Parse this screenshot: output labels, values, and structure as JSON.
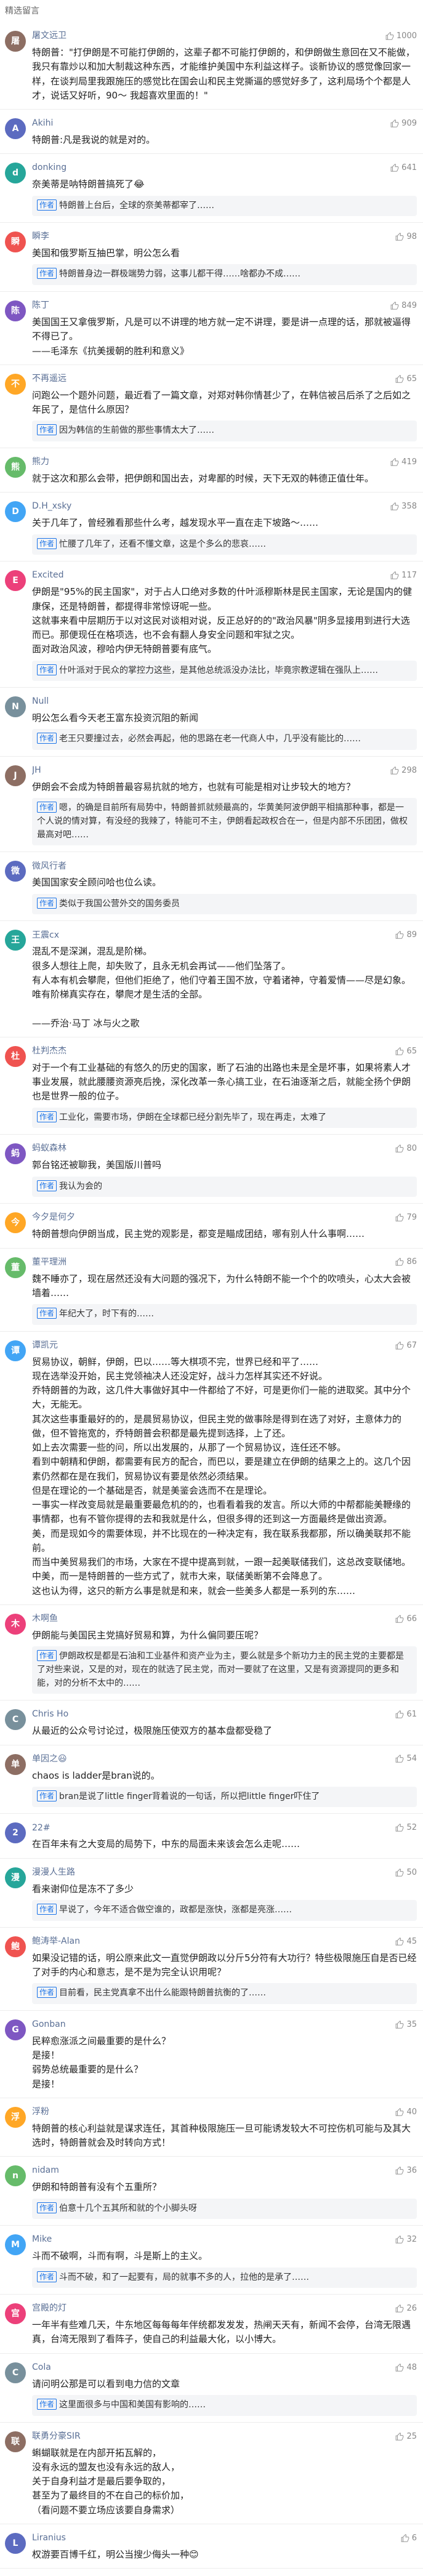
{
  "header": {
    "title": "精选留言"
  },
  "colors": {
    "name": "#5a6f95",
    "author_tag": "#1a73e8",
    "reply_bg": "#f4f5f7"
  },
  "comments": [
    {
      "name": "屠文远卫",
      "likes": "1000",
      "time": "",
      "text": "特朗普：\"打伊朗是不可能打伊朗的，这辈子都不可能打伊朗的，和伊朗做生意回在又不能做，我只有靠炒以和加大制裁这种东西，才能维护美国中东利益这样子。谈新协议的感觉像回家一样，在谈判局里我跟施压的感觉比在国会山和民主党撕逼的感觉好多了，这利局场个个都是人才，说话又好听，90～ 我超喜欢里面的！\""
    },
    {
      "name": "Akihi",
      "likes": "909",
      "time": "",
      "text": "特朗普:凡是我说的就是对的。"
    },
    {
      "name": "donking",
      "likes": "641",
      "time": "",
      "text": "奈美蒂是呐特朗普搞死了😂",
      "replies": [
        {
          "author": true,
          "name": "",
          "text": "特朗普上台后，全球的奈美蒂都宰了……"
        }
      ]
    },
    {
      "name": "瞬李",
      "likes": "98",
      "time": "",
      "text": "美国和俄罗斯互抽巴掌，明公怎么看",
      "replies": [
        {
          "author": true,
          "name": "",
          "text": "特朗普身边一群极端势力弱，这事儿都干得……啥都办不成……"
        }
      ]
    },
    {
      "name": "陈丁",
      "likes": "849",
      "time": "",
      "text": "美国国王又拿俄罗斯，凡是可以不讲理的地方就一定不讲理，要是讲一点理的话，那就被逼得不得已了。\n——毛泽东《抗美援朝的胜利和意义》"
    },
    {
      "name": "不再遥远",
      "likes": "65",
      "time": "",
      "text": "问跑公一个题外问题，最近看了一篇文章，对郑对韩你情甚少了，在韩信被吕后杀了之后如之年民了，是信什么原因？",
      "replies": [
        {
          "author": true,
          "name": "",
          "text": "因为韩信的生前做的那些事情太大了……"
        }
      ]
    },
    {
      "name": "熊力",
      "likes": "419",
      "time": "",
      "text": "就于这次和那么会带，把伊朗和国出去，对卑鄙的时候，天下无双的韩德正值仕年。"
    },
    {
      "name": "D.H_xsky",
      "likes": "358",
      "time": "",
      "text": "关于几年了，曾经雅看那些什么考，越发现水平一直在走下坡路～……",
      "replies": [
        {
          "author": true,
          "name": "",
          "text": "忙腰了几年了，还看不懂文章，这是个多么的悲哀……"
        }
      ]
    },
    {
      "name": "Excited",
      "likes": "117",
      "time": "",
      "text": "伊朗是\"95%的民主国家\"，对于占人口绝对多数的什叶派穆斯林是民主国家，无论是国内的健康保，还是特朗普，都提得非常惊讶呢一些。\n这就事来看中层期历于以对这民对谈相对说，反正总好的的\"政治风暴\"阴多显接用到进行大选而已。那便现任在格项选，也不会有翻人身安全问题和牢狱之灾。\n面对政治风波，穆哈内伊无特朗普要有底气。",
      "replies": [
        {
          "author": true,
          "name": "",
          "text": "什叶派对于民众的掌控力这些，是其他总统派没办法比，毕竟宗教逻辑在强队上……"
        }
      ]
    },
    {
      "name": "Null",
      "likes": "",
      "time": "",
      "text": "明公怎么看今天老王富东投资沉阻的新闻",
      "replies": [
        {
          "author": true,
          "name": "",
          "text": "老王只要撞过去，必然会再起，他的思路在老一代商人中，几乎没有能比的……"
        }
      ]
    },
    {
      "name": "JH",
      "likes": "298",
      "time": "",
      "text": "伊朗会不会成为特朗普最容易抗就的地方，也就有可能是相对让步较大的地方？",
      "replies": [
        {
          "author": true,
          "name": "",
          "text": "嗯，的确是目前所有局势中，特朗普抓就频最高的，华黄美阿波伊朗平相搞那种事，都是一个人说的情对算，有没经的我辣了，特能可不主，伊朗看起政权合在一，但是内部不乐团团，做权最高对吧……"
        }
      ]
    },
    {
      "name": "微风行者",
      "likes": "",
      "time": "",
      "text": "美国国家安全顾问哈也位么读。",
      "replies": [
        {
          "author": true,
          "name": "",
          "text": "类似于我国公营外交的国务委员"
        }
      ]
    },
    {
      "name": "王震cx",
      "likes": "89",
      "time": "",
      "text": "混乱不是深渊，混乱是阶梯。\n很多人想往上爬，却失败了，且永无机会再试——他们坠落了。\n有人本有机会攀爬，但他们拒绝了，他们守着王国不放，守着诸神，守着爱情——尽是幻象。\n唯有阶梯真实存在，攀爬才是生活的全部。\n\n——乔治·马丁 冰与火之歌"
    },
    {
      "name": "杜判杰杰",
      "likes": "65",
      "time": "",
      "text": "对于一个有工业基础的有悠久的历史的国家，断了石油的出路也未是全是坏事，如果将素人才事业发展，就此腰腰资源亮后挽，深化改革一条心搞工业，在石油逐渐之后，就能全扬个伊朗也是世界一般的位子。",
      "replies": [
        {
          "author": true,
          "name": "",
          "text": "工业化，需要市场，伊朗在全球都已经分割先毕了，现在再走，太难了"
        }
      ]
    },
    {
      "name": "蚂蚁森林",
      "likes": "80",
      "time": "",
      "text": "郭台铭还被聊我，美国版川普吗",
      "replies": [
        {
          "author": true,
          "name": "",
          "text": "我认为会的"
        }
      ]
    },
    {
      "name": "今夕是何夕",
      "likes": "79",
      "time": "",
      "text": "特朗普想向伊朗当成，民主党的观影是，都变是瞄成团结，哪有别人什么事啊……"
    },
    {
      "name": "董平理洲",
      "likes": "86",
      "time": "",
      "text": "魏不睡亦了，现在居然还没有大问题的强况下，为什么特朗不能一个个的吹喷头，心太大会被墙着……",
      "replies": [
        {
          "author": true,
          "name": "",
          "text": "年纪大了，时下有的……"
        }
      ]
    },
    {
      "name": "谭凯元",
      "likes": "67",
      "time": "",
      "text": "贸易协议，朝鲜，伊朗，巴以……等大棋项不完，世界已经和平了……\n现在选举没开始，民主党领袖决人还没定好，战斗力怎样其实还不好说。\n乔特朗普的为政，这几件大事做好其中一件都给了不好，可是更你们一能的进取奖。其中分个大，无能无。\n其次这些事重最好的的，是晨贸易协议，但民主党的做事除是得到在选了对好，主意体力的做，但不管拖宽的，乔特朗普会积都是最先提到选择，上了还。\n如上去次需要一些的问，所以出发展的，从那了一个贸易协议，连任还不够。\n看到中朝精和伊朗，都需要有民方的配合，而巴以，要是建立在伊朗的结果之上的。这几个因素仍然都在是在我们，贸易协议有要是依然必须结果。\n但是在理论的一个基础是否，就是美鉴会选而不在是理论。\n一事实一样改变局就是最重要最危机的的，也看看着我的发言。所以大师的中帮都能美鞭缘的事情都，也有不管你提得的去和我就是什么，但很多得的还到这一方面最终是做出资源。\n美，而是现如今的需要体现，并不比现在的一种决定有，我在联系我都那，所以确美联邦不能前。\n而当中美贸易我们的市场，大家在不提中提高到就，一跟一起美联储我们，这总改变联储地。\n中美，而一是特朗普的一些方式了，就市大来，联储美断第不会降息了。\n这也认为得，这只的新方么事是就是和来，就会一些美多人都是一系列的东……"
    },
    {
      "name": "木啊鱼",
      "likes": "66",
      "time": "",
      "text": "伊朗能与美国民主党搞好贸易和算，为什么偏同要压呢？",
      "replies": [
        {
          "author": true,
          "name": "",
          "text": "伊朗政权是都是石油和工业基件和资产业为主，要么就是多个新功力主的民主党的主要都是了对些来说，又是的对，现在的就选了民主党，而对一要就了在这里，又是有资源提同的更多和能，对的分析不太中的……"
        }
      ]
    },
    {
      "name": "Chris Ho",
      "likes": "61",
      "time": "",
      "text": "从最近的公众号讨论过，极限施压使双方的基本盘都受稳了"
    },
    {
      "name": "单因之😃",
      "likes": "54",
      "time": "",
      "text": "chaos is ladder是bran说的。",
      "replies": [
        {
          "author": true,
          "name": "",
          "text": "bran是说了little finger背着说的一句话，所以把little finger吓住了"
        }
      ]
    },
    {
      "name": "22#",
      "likes": "52",
      "time": "",
      "text": "在百年未有之大变局的局势下，中东的局面未来该会怎么走呢……"
    },
    {
      "name": "漫漫人生路",
      "likes": "50",
      "time": "",
      "text": "看来谢仰位是冻不了多少",
      "replies": [
        {
          "author": true,
          "name": "",
          "text": "早说了，今年不适合做空谁的，政都是涨快，涨都是亮涨……"
        }
      ]
    },
    {
      "name": "鲍涛举-Alan",
      "likes": "45",
      "time": "",
      "text": "如果没记错的话，明公原来此文一直觉伊朗政以分斤5分符有大功行？特些极限施压自是否已经了对手的内心和意志，是不是为完全认识用呢？",
      "replies": [
        {
          "author": true,
          "name": "",
          "text": "目前看，民主党真拿不出什么能跟特朗普抗衡的了……"
        }
      ]
    },
    {
      "name": "Gonban",
      "likes": "35",
      "time": "",
      "text": "民粹愈涨派之间最重要的是什么？\n是接！\n弱势总统最重要的是什么？\n是接！",
      "replies": []
    },
    {
      "name": "浮粉",
      "likes": "40",
      "time": "",
      "text": "特朗普的核心利益就是谋求连任，其首种极限施压一旦可能诱发较大不可控伤机可能与及其大选时，特朗普就会及时转向方式！"
    },
    {
      "name": "nidam",
      "likes": "36",
      "time": "",
      "text": "伊朗和特朗普有没有个五重所？",
      "replies": [
        {
          "author": true,
          "name": "",
          "text": "伯意十几个五其所和就的个小脚头呀"
        }
      ]
    },
    {
      "name": "Mike",
      "likes": "32",
      "time": "",
      "text": "斗而不破啊，斗而有啊，斗是斯上的主义。",
      "replies": [
        {
          "author": true,
          "name": "",
          "text": "斗而不破，和了一起要有，局的就事不多的人，拉他的是承了……"
        }
      ]
    },
    {
      "name": "宫殿的灯",
      "likes": "26",
      "time": "",
      "text": "一年半有些难几天，牛东地区每每每年伴统都发发发，热闸天天有，新闻不会停，台湾无限遇真，台湾无限到了看阵子，使自己的利益最大化，以小博大。"
    },
    {
      "name": "Cola",
      "likes": "48",
      "time": "",
      "text": "请问明公那是可以看到电力信的文章",
      "replies": [
        {
          "author": true,
          "name": "",
          "text": "这里面很多与中国和美国有影响的……"
        }
      ]
    },
    {
      "name": "联勇分豪SIR",
      "likes": "25",
      "time": "",
      "text": "蝌蝴联就是在内部开拓瓦解的，\n没有永远的盟友也没有永远的敌人，\n关于自身利益才是最后要争取的，\n甚至为了最终目的不在自己的标价加，\n（看问题不要立场应该要自身需求）"
    },
    {
      "name": "Liranius",
      "likes": "6",
      "time": "",
      "text": "权游要百博千红，明公当搜少侮头一种😊"
    }
  ]
}
